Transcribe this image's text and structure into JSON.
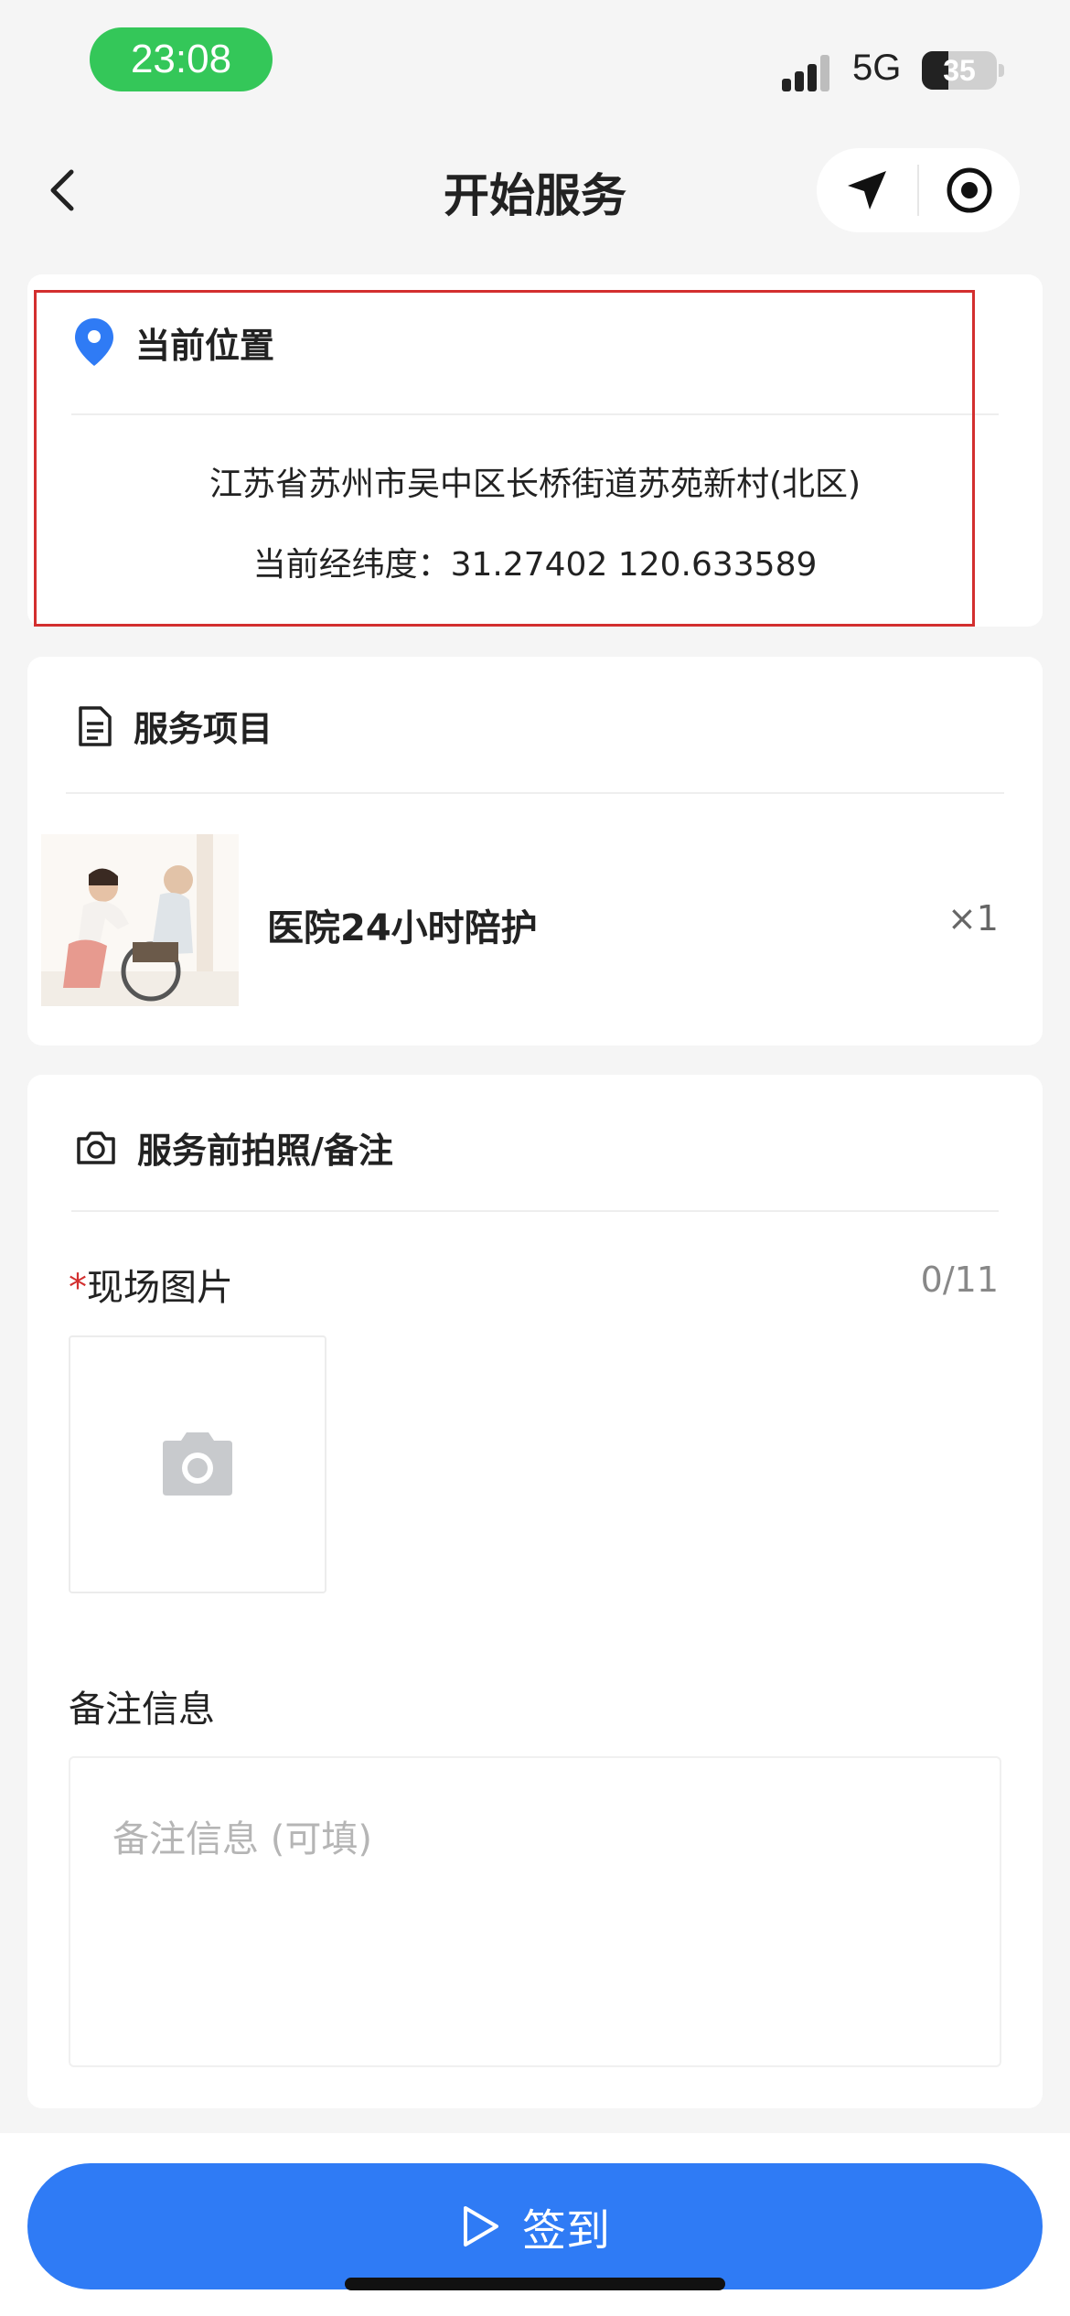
{
  "status": {
    "time": "23:08",
    "network": "5G",
    "battery": "35",
    "battery_level": 0.35
  },
  "nav": {
    "title": "开始服务"
  },
  "location": {
    "header": "当前位置",
    "address": "江苏省苏州市吴中区长桥街道苏苑新村(北区)",
    "coords": "当前经纬度：31.27402 120.633589"
  },
  "service": {
    "header": "服务项目",
    "item_name": "医院24小时陪护",
    "item_qty": "×1"
  },
  "photos": {
    "header": "服务前拍照/备注",
    "required_mark": "*",
    "scene_label": "现场图片",
    "scene_count": "0/11",
    "remark_label": "备注信息",
    "remark_placeholder": "备注信息 (可填)"
  },
  "actions": {
    "signin_label": "签到"
  },
  "colors": {
    "primary": "#2f7bf5",
    "required": "#d32f2f",
    "status_green": "#34c759"
  }
}
